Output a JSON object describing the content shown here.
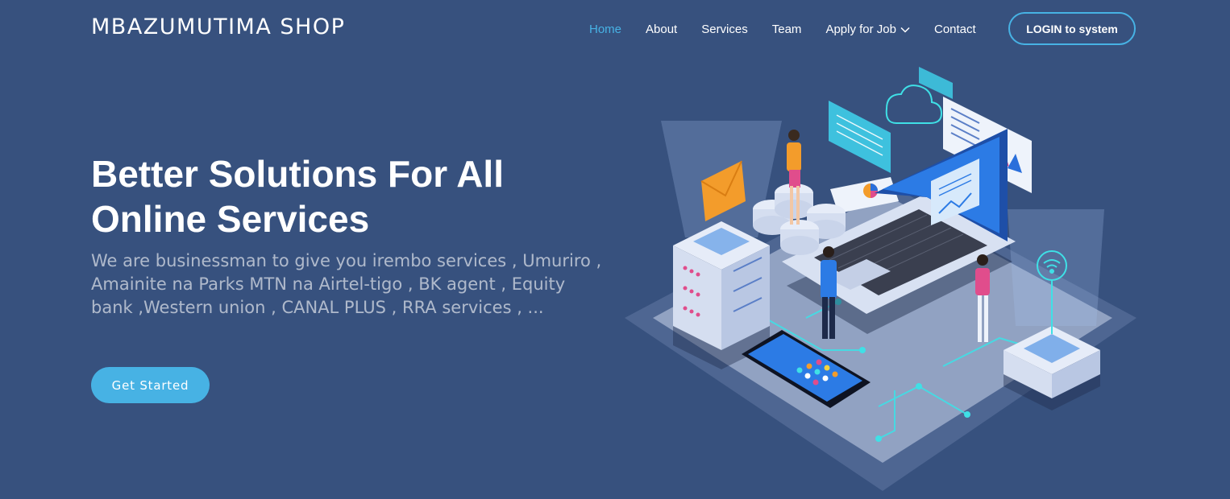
{
  "brand": {
    "logo_text": "MBAZUMUTIMA SHOP"
  },
  "nav": {
    "items": [
      {
        "label": "Home",
        "active": true
      },
      {
        "label": "About"
      },
      {
        "label": "Services"
      },
      {
        "label": "Team"
      },
      {
        "label": "Apply for Job",
        "has_dropdown": true
      },
      {
        "label": "Contact"
      }
    ],
    "login_label": "LOGIN to system"
  },
  "hero": {
    "title_line1": "Better Solutions For All",
    "title_line2": "Online Services",
    "subtitle": "We are businessman to give you irembo services , Umuriro , Amainite na Parks MTN na Airtel-tigo , BK agent , Equity bank ,Western union , CANAL PLUS , RRA services , ...",
    "cta_label": "Get Started"
  },
  "colors": {
    "background": "#37517e",
    "accent": "#47b2e4",
    "text": "#ffffff"
  },
  "icons": [
    "chevron-down-icon",
    "cloud-icon",
    "envelope-icon",
    "wifi-icon",
    "pie-chart-icon",
    "bar-chart-icon"
  ]
}
